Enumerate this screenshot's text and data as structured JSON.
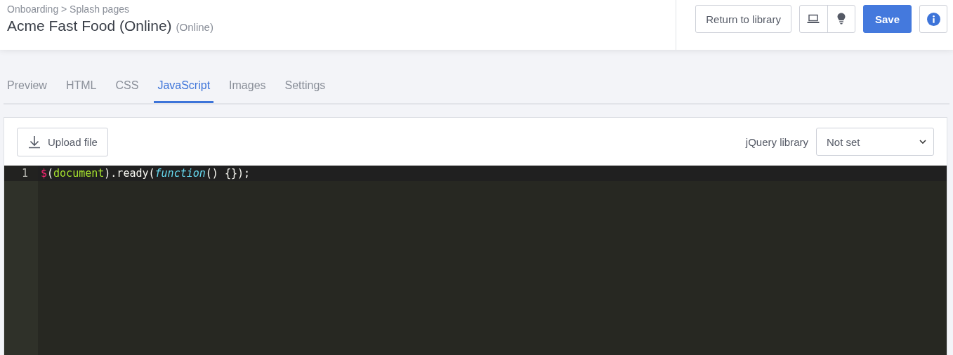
{
  "header": {
    "breadcrumb": "Onboarding > Splash pages",
    "title": "Acme Fast Food (Online)",
    "subtitle": "(Online)",
    "buttons": {
      "return": "Return to library",
      "save": "Save"
    }
  },
  "tabs": [
    {
      "label": "Preview",
      "selected": false
    },
    {
      "label": "HTML",
      "selected": false
    },
    {
      "label": "CSS",
      "selected": false
    },
    {
      "label": "JavaScript",
      "selected": true
    },
    {
      "label": "Images",
      "selected": false
    },
    {
      "label": "Settings",
      "selected": false
    }
  ],
  "toolbar": {
    "upload": "Upload file",
    "library_label": "jQuery library",
    "library_value": "Not set"
  },
  "editor": {
    "lines": [
      {
        "number": "1",
        "active": true,
        "tokens": [
          {
            "text": "$",
            "kind": "special"
          },
          {
            "text": "(",
            "kind": "plain"
          },
          {
            "text": "document",
            "kind": "variable"
          },
          {
            "text": ").ready(",
            "kind": "plain"
          },
          {
            "text": "function",
            "kind": "keyword"
          },
          {
            "text": "() {});",
            "kind": "plain"
          }
        ]
      }
    ]
  }
}
